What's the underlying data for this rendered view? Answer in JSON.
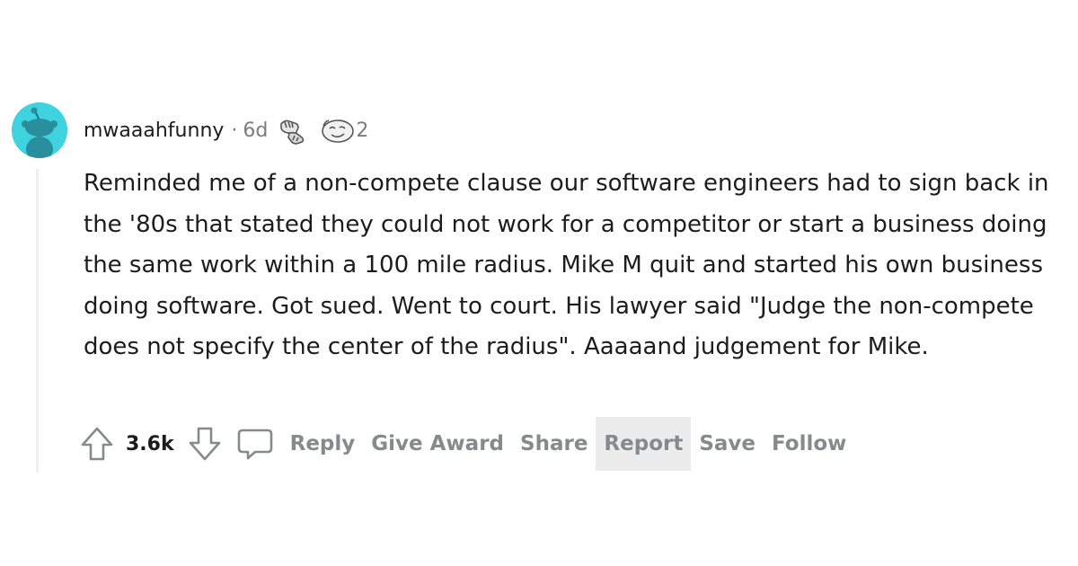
{
  "comment": {
    "username": "mwaaahfunny",
    "separator": "·",
    "age": "6d",
    "award_count": "2",
    "body": "Reminded me of a non-compete clause our software engineers had to sign back in the '80s that stated they could not work for a competitor or start a business doing the same work within a 100 mile radius. Mike M quit and started his own business doing software. Got sued. Went to court. His lawyer said \"Judge the non-compete does not specify the center of the radius\". Aaaaand judgement for Mike.",
    "score": "3.6k"
  },
  "actions": {
    "reply": "Reply",
    "give_award": "Give Award",
    "share": "Share",
    "report": "Report",
    "save": "Save",
    "follow": "Follow"
  },
  "icons": {
    "upvote": "upvote-arrow-icon",
    "downvote": "downvote-arrow-icon",
    "reply": "speech-bubble-icon",
    "award_1": "fist-bump-award-icon",
    "award_2": "face-award-icon"
  },
  "colors": {
    "avatar_bg": "#3fd3e0",
    "text": "#1c1c1c",
    "meta": "#7c7c7c",
    "action": "#878a8c",
    "hover_bg": "#ececec",
    "thread_line": "#edeff1"
  }
}
